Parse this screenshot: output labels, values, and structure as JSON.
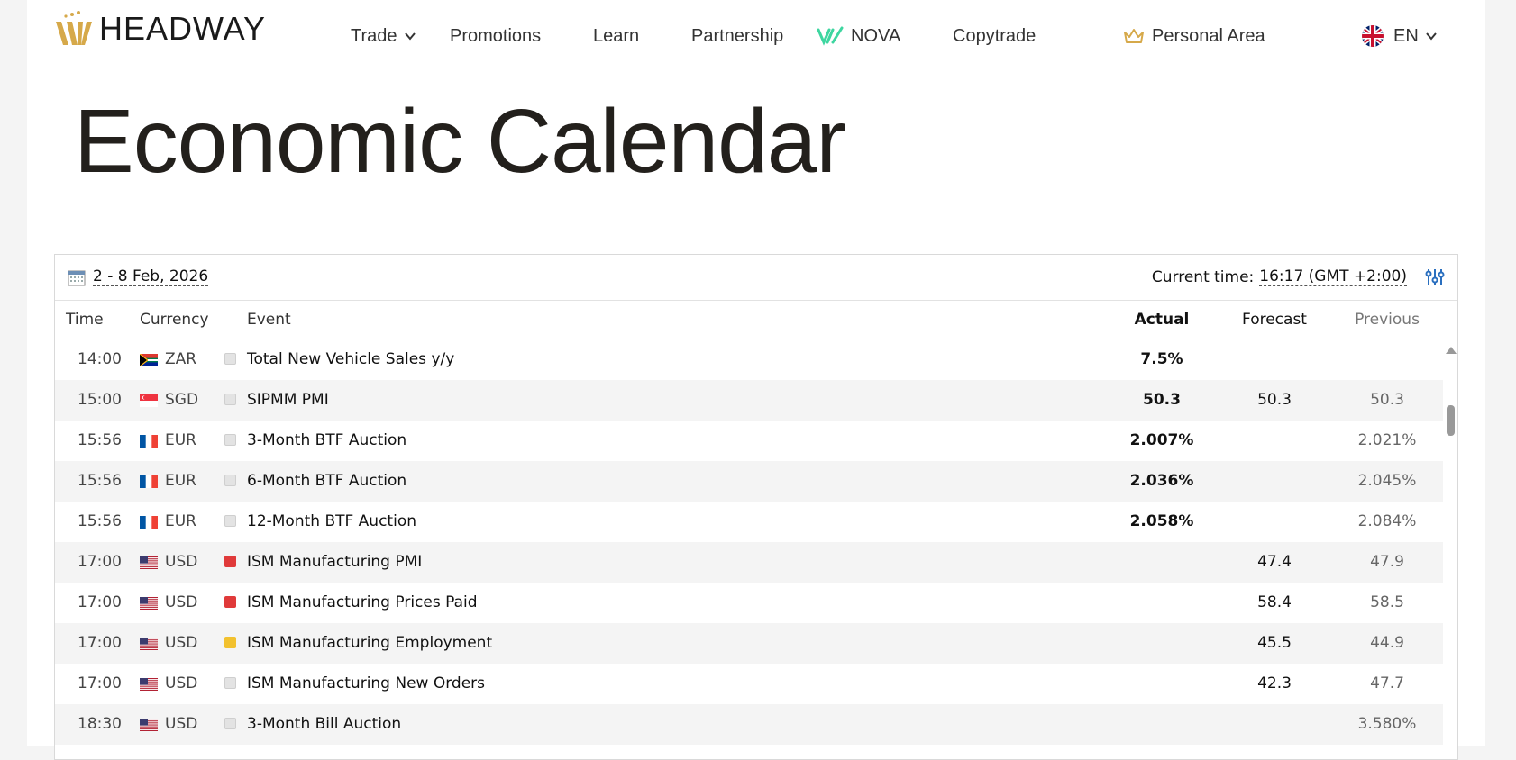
{
  "header": {
    "logo_text": "HEADWAY",
    "nav": [
      {
        "label": "Trade",
        "has_dropdown": true
      },
      {
        "label": "Promotions"
      },
      {
        "label": "Learn"
      },
      {
        "label": "Partnership"
      },
      {
        "label": "NOVA",
        "icon": "nova-icon"
      },
      {
        "label": "Copytrade"
      },
      {
        "label": "Personal Area",
        "icon": "crown-icon"
      },
      {
        "label": "EN",
        "icon": "uk-flag-icon",
        "has_dropdown": true
      }
    ],
    "accent_gold": "#d6a94a",
    "accent_nova": "#3ed6a0"
  },
  "page_title": "Economic Calendar",
  "calendar": {
    "date_range": "2 - 8 Feb, 2026",
    "current_time_label": "Current time:",
    "current_time_value": "16:17 (GMT +2:00)",
    "columns": {
      "time": "Time",
      "currency": "Currency",
      "event": "Event",
      "actual": "Actual",
      "forecast": "Forecast",
      "previous": "Previous"
    },
    "rows": [
      {
        "time": "14:00",
        "flag": "za",
        "currency": "ZAR",
        "importance": "low",
        "event": "Total New Vehicle Sales y/y",
        "actual": "7.5%",
        "forecast": "",
        "previous": ""
      },
      {
        "time": "15:00",
        "flag": "sg",
        "currency": "SGD",
        "importance": "low",
        "event": "SIPMM PMI",
        "actual": "50.3",
        "forecast": "50.3",
        "previous": "50.3"
      },
      {
        "time": "15:56",
        "flag": "fr",
        "currency": "EUR",
        "importance": "low",
        "event": "3-Month BTF Auction",
        "actual": "2.007%",
        "forecast": "",
        "previous": "2.021%"
      },
      {
        "time": "15:56",
        "flag": "fr",
        "currency": "EUR",
        "importance": "low",
        "event": "6-Month BTF Auction",
        "actual": "2.036%",
        "forecast": "",
        "previous": "2.045%"
      },
      {
        "time": "15:56",
        "flag": "fr",
        "currency": "EUR",
        "importance": "low",
        "event": "12-Month BTF Auction",
        "actual": "2.058%",
        "forecast": "",
        "previous": "2.084%"
      },
      {
        "time": "17:00",
        "flag": "us",
        "currency": "USD",
        "importance": "high",
        "event": "ISM Manufacturing PMI",
        "actual": "",
        "forecast": "47.4",
        "previous": "47.9"
      },
      {
        "time": "17:00",
        "flag": "us",
        "currency": "USD",
        "importance": "high",
        "event": "ISM Manufacturing Prices Paid",
        "actual": "",
        "forecast": "58.4",
        "previous": "58.5"
      },
      {
        "time": "17:00",
        "flag": "us",
        "currency": "USD",
        "importance": "medium",
        "event": "ISM Manufacturing Employment",
        "actual": "",
        "forecast": "45.5",
        "previous": "44.9"
      },
      {
        "time": "17:00",
        "flag": "us",
        "currency": "USD",
        "importance": "low",
        "event": "ISM Manufacturing New Orders",
        "actual": "",
        "forecast": "42.3",
        "previous": "47.7"
      },
      {
        "time": "18:30",
        "flag": "us",
        "currency": "USD",
        "importance": "low",
        "event": "3-Month Bill Auction",
        "actual": "",
        "forecast": "",
        "previous": "3.580%"
      }
    ]
  }
}
